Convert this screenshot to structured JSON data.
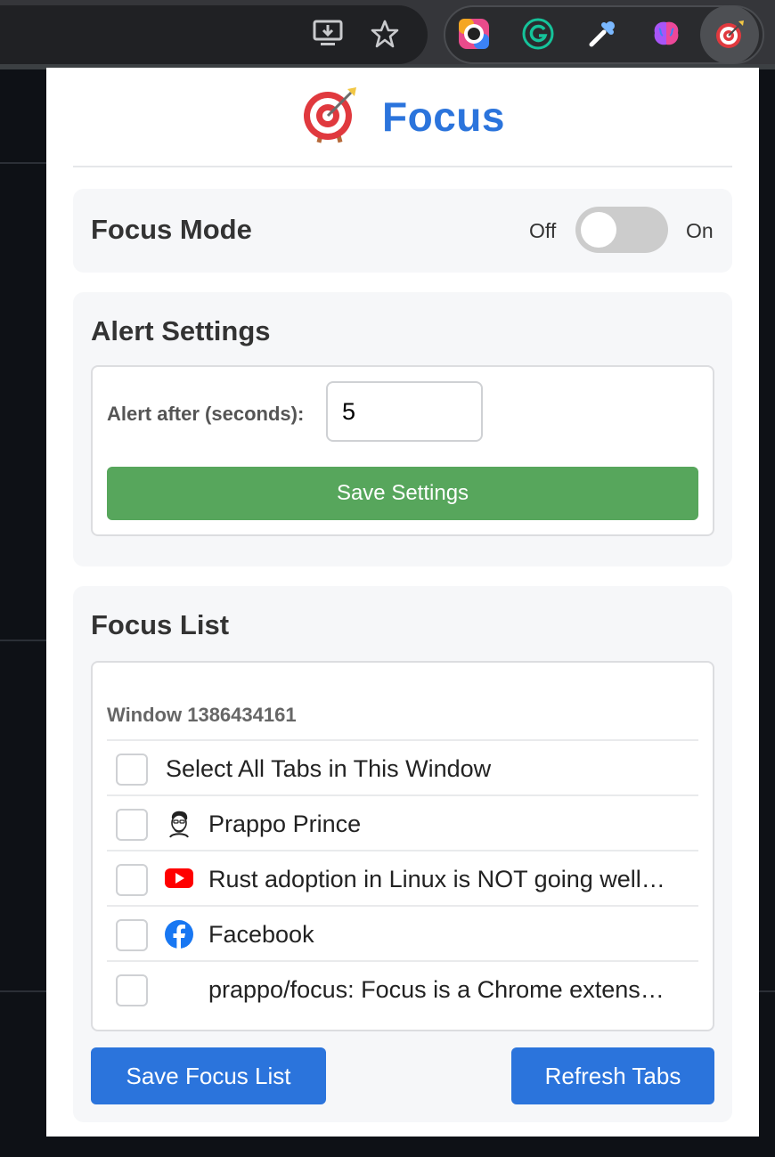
{
  "colors": {
    "accent": "#2b74dc",
    "save_settings_green": "#57a65c",
    "toggle_off": "#cccccc",
    "card_bg": "#f6f7f9"
  },
  "toolbar": {
    "icons": [
      "install-app-icon",
      "bookmark-star-icon",
      "screen-recorder-extension-icon",
      "grammarly-extension-icon",
      "color-picker-extension-icon",
      "brain-extension-icon",
      "focus-target-extension-icon"
    ]
  },
  "header": {
    "icon": "target-dart-icon",
    "title": "Focus"
  },
  "focus_mode": {
    "label": "Focus Mode",
    "off_label": "Off",
    "on_label": "On",
    "enabled": false
  },
  "alert_settings": {
    "title": "Alert Settings",
    "input_label": "Alert after (seconds):",
    "input_value": "5",
    "save_label": "Save Settings"
  },
  "focus_list": {
    "title": "Focus List",
    "window_label": "Window 1386434161",
    "tabs": [
      {
        "label": "Select All Tabs in This Window",
        "favicon": "",
        "checked": false
      },
      {
        "label": "Prappo Prince",
        "favicon": "avatar-favicon",
        "checked": false
      },
      {
        "label": "Rust adoption in Linux is NOT going well…",
        "favicon": "youtube-favicon",
        "checked": false
      },
      {
        "label": "Facebook",
        "favicon": "facebook-favicon",
        "checked": false
      },
      {
        "label": "prappo/focus: Focus is a Chrome extens…",
        "favicon": "github-favicon",
        "checked": false
      }
    ],
    "save_label": "Save Focus List",
    "refresh_label": "Refresh Tabs"
  }
}
